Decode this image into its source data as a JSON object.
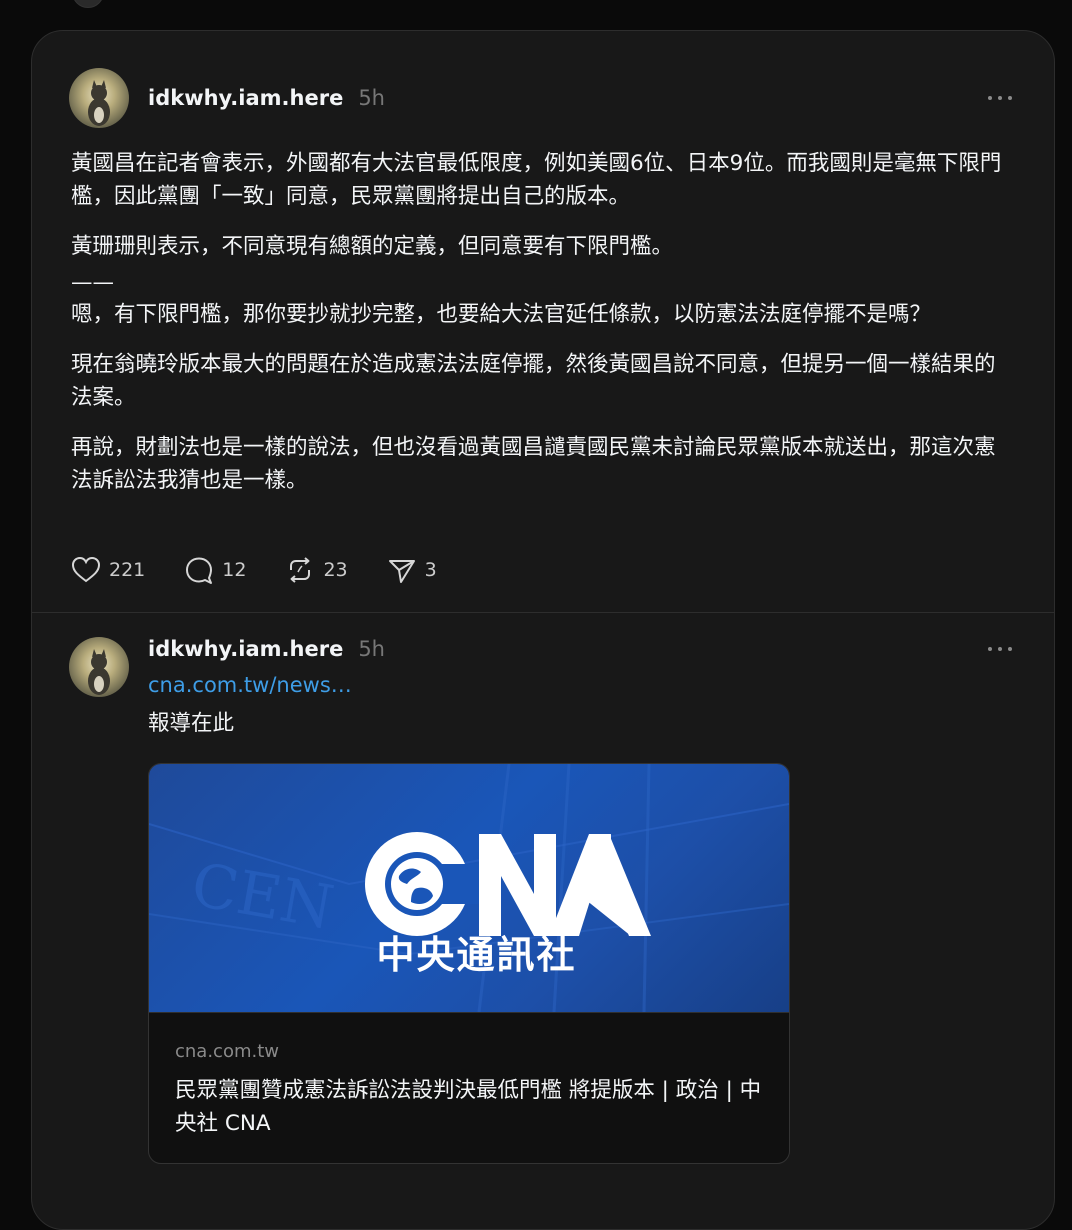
{
  "posts": [
    {
      "username": "idkwhy.iam.here",
      "time": "5h",
      "paragraphs": [
        "黃國昌在記者會表示，外國都有大法官最低限度，例如美國6位、日本9位。而我國則是毫無下限門檻，因此黨團「一致」同意，民眾黨團將提出自己的版本。",
        "黃珊珊則表示，不同意現有總額的定義，但同意要有下限門檻。",
        "——",
        "嗯，有下限門檻，那你要抄就抄完整，也要給大法官延任條款，以防憲法法庭停擺不是嗎？",
        "現在翁曉玲版本最大的問題在於造成憲法法庭停擺，然後黃國昌說不同意，但提另一個一樣結果的法案。",
        "再說，財劃法也是一樣的說法，但也沒看過黃國昌譴責國民黨未討論民眾黨版本就送出，那這次憲法訴訟法我猜也是一樣。"
      ],
      "actions": {
        "likes": "221",
        "replies": "12",
        "reposts": "23",
        "shares": "3"
      }
    },
    {
      "username": "idkwhy.iam.here",
      "time": "5h",
      "link_text": "cna.com.tw/news…",
      "caption": "報導在此",
      "preview": {
        "logo_text": "CNA",
        "logo_subtitle": "中央通訊社",
        "domain": "cna.com.tw",
        "title": "民眾黨團贊成憲法訴訟法設判決最低門檻 將提版本 | 政治 | 中央社 CNA",
        "bg_color": "#1a56b8"
      }
    }
  ]
}
